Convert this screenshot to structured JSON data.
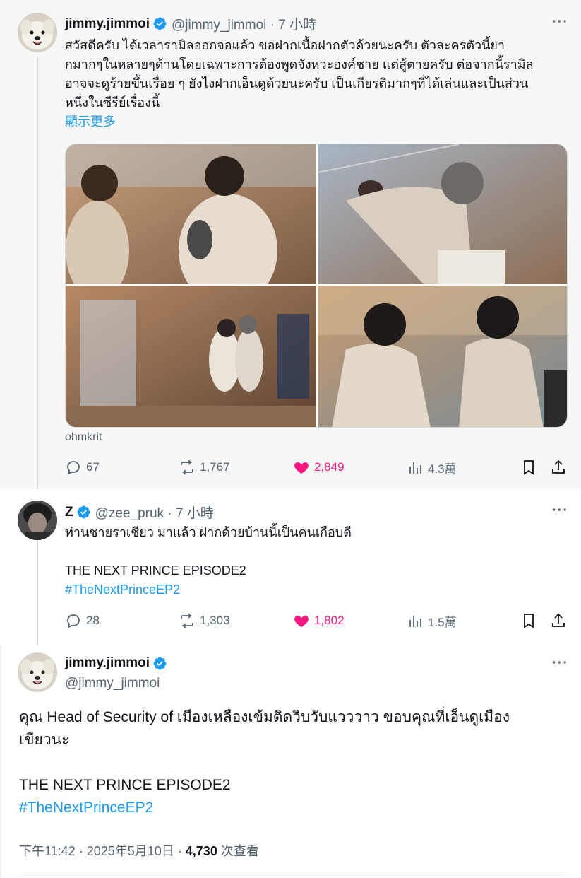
{
  "tweet1": {
    "display_name": "jimmy.jimmoi",
    "handle_time": "@jimmy_jimmoi · 7 小時",
    "text_lines": [
      "สวัสดีครับ ได้เวลารามิลออกจอแล้ว ขอฝากเนื้อฝากตัวด้วยนะครับ ตัวละครตัวนี้ยา",
      "กมากๆในหลายๆด้านโดยเฉพาะการต้องพูดจังหวะองค์ชาย แต่สู้ตายครับ ต่อจากนี้รามิล",
      "อาจจะดูร้ายขึ้นเรื่อย ๆ ยังไงฝากเอ็นดูด้วยนะครับ เป็นเกียรติมากๆที่ได้เล่นและเป็นส่วน",
      "หนึ่งในซีรีย์เรื่องนี้"
    ],
    "show_more": "顯示更多",
    "media_source": "ohmkrit",
    "replies": "67",
    "reposts": "1,767",
    "likes": "2,849",
    "views": "4.3萬"
  },
  "tweet2": {
    "display_name": "Z",
    "handle_time": "@zee_pruk · 7 小時",
    "text_line1": "ท่านชายราเชียว มาแล้ว ฝากด้วยบ้านนี้เป็นคนเกือบดี",
    "text_line2": "THE NEXT PRINCE EPISODE2",
    "hashtag": "#TheNextPrinceEP2",
    "replies": "28",
    "reposts": "1,303",
    "likes": "1,802",
    "views": "1.5萬"
  },
  "tweet3": {
    "display_name": "jimmy.jimmoi",
    "handle": "@jimmy_jimmoi",
    "text_line1": "คุณ Head of Security of เมืองเหลืองเข้มติดวิบวับแวววาว ขอบคุณที่เอ็นดูเมือง",
    "text_line2": "เขียวนะ",
    "text_line3": "THE NEXT PRINCE EPISODE2",
    "hashtag": "#TheNextPrinceEP2",
    "timestamp": "下午11:42 · 2025年5月10日 · ",
    "view_count": "4,730",
    "view_suffix": " 次查看"
  },
  "more_label": "···",
  "colors": {
    "accent": "#1d9bf0",
    "like": "#f91880",
    "muted": "#536471"
  }
}
